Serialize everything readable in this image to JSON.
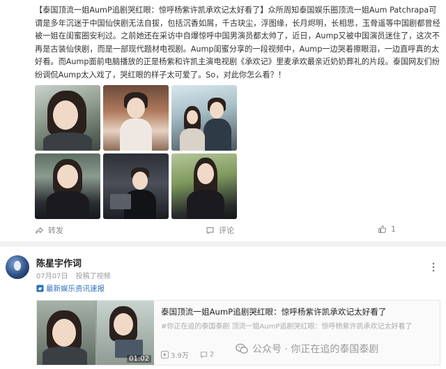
{
  "post": {
    "text": "【泰国顶流一姐AumP追剧哭红眼：惊呼杨紫许凯承欢记太好看了】众所周知泰国娱乐圈顶流一姐Aum Patchrapa可谓是多年沉迷于中国仙侠剧无法自拔，包括沉香如屑，千古玦尘，浮图缘，长月烬明，长相思，玉骨遥等中国剧都曾经被一姐在闺蜜圈安利过。之前她还在采访中自爆惊呼中国男演员都太帅了，近日，Aump又被中国演员迷住了，这次不再是古装仙侠剧，而是一部现代题材电视剧。Aump闺蜜分享的一段视频中，Aump一边哭着擦眼泪，一边直呼真的太好看。而Aump面前电脑播放的正是杨紫和许凯主演电视剧《承欢记》里麦承欢最亲近奶奶葬礼的片段。泰国网友们纷纷调侃Aump太入戏了，哭红眼的样子太可爱了。So，对此你怎么看？！",
    "actions": {
      "repost_label": "转发",
      "comment_label": "评论",
      "like_count": "1"
    },
    "icons": [
      "share-icon",
      "comment-icon",
      "like-icon"
    ]
  },
  "card": {
    "author": "陈星宇作词",
    "date": "07月07日",
    "source": "投稿了视频",
    "tag": "最新娱乐资讯速报",
    "video": {
      "duration": "01:02",
      "title": "泰国顶流一姐AumP追剧哭红眼：惊呼杨紫许凯承欢记太好看了",
      "subtitle": "#你正在追的泰国泰剧 顶流一姐AumP追剧哭红眼：惊呼杨紫许凯承欢记太好看了",
      "views": "3.9万",
      "comments": "2"
    },
    "watermark": "公众号 · 你正在追的泰国泰剧"
  },
  "colors": {
    "link": "#2f6fb5",
    "muted": "#999999",
    "separator": "#f2f2f2"
  }
}
